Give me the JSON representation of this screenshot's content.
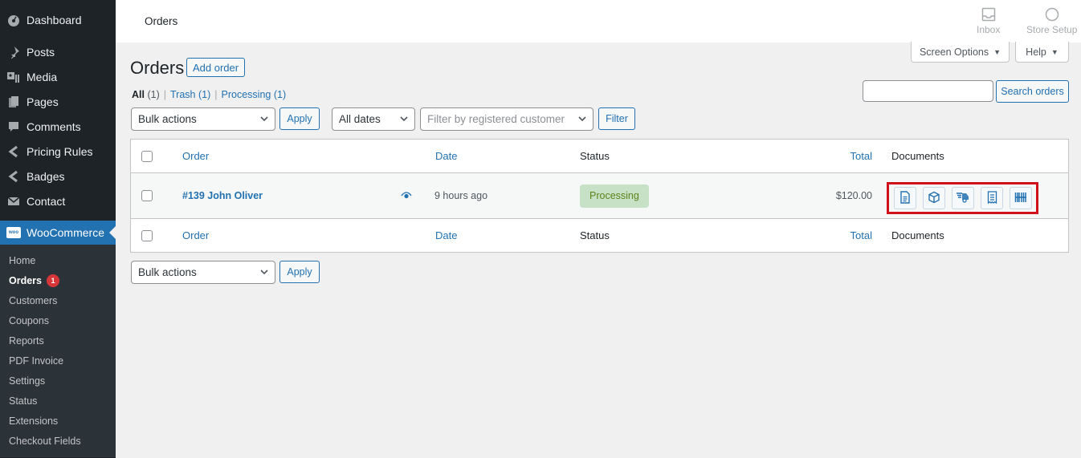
{
  "sidebar": {
    "items": [
      {
        "label": "Dashboard",
        "icon": "dashboard-icon"
      },
      {
        "label": "Posts",
        "icon": "pin-icon"
      },
      {
        "label": "Media",
        "icon": "media-icon"
      },
      {
        "label": "Pages",
        "icon": "pages-icon"
      },
      {
        "label": "Comments",
        "icon": "comment-icon"
      },
      {
        "label": "Pricing Rules",
        "icon": "chevron-left-icon"
      },
      {
        "label": "Badges",
        "icon": "chevron-left-icon"
      },
      {
        "label": "Contact",
        "icon": "envelope-icon"
      }
    ],
    "woocommerce": {
      "label": "WooCommerce",
      "logo_text": "woo"
    },
    "submenu": [
      {
        "label": "Home"
      },
      {
        "label": "Orders",
        "badge": "1",
        "current": true
      },
      {
        "label": "Customers"
      },
      {
        "label": "Coupons"
      },
      {
        "label": "Reports"
      },
      {
        "label": "PDF Invoice"
      },
      {
        "label": "Settings"
      },
      {
        "label": "Status"
      },
      {
        "label": "Extensions"
      },
      {
        "label": "Checkout Fields"
      }
    ]
  },
  "topbar": {
    "title": "Orders",
    "actions": [
      {
        "label": "Inbox",
        "icon": "inbox-icon"
      },
      {
        "label": "Store Setup",
        "icon": "circle-progress-icon"
      }
    ]
  },
  "screen_meta": {
    "screen_options": "Screen Options",
    "help": "Help"
  },
  "page": {
    "title": "Orders",
    "add_button": "Add order",
    "views": [
      {
        "label": "All",
        "count": "(1)",
        "current": true
      },
      {
        "label": "Trash",
        "count": "(1)"
      },
      {
        "label": "Processing",
        "count": "(1)"
      }
    ],
    "search": {
      "value": "",
      "button": "Search orders"
    }
  },
  "filters": {
    "bulk_actions": "Bulk actions",
    "apply": "Apply",
    "dates": "All dates",
    "customer_placeholder": "Filter by registered customer",
    "filter": "Filter"
  },
  "table": {
    "columns": [
      "Order",
      "Date",
      "Status",
      "Total",
      "Documents"
    ],
    "rows": [
      {
        "order": "#139 John Oliver",
        "date": "9 hours ago",
        "status": "Processing",
        "total": "$120.00",
        "documents": [
          "invoice-icon",
          "packing-slip-icon",
          "delivery-note-icon",
          "receipt-icon",
          "barcode-icon"
        ]
      }
    ]
  },
  "colors": {
    "accent": "#2271b1",
    "sidebar_bg": "#1d2327",
    "status_processing_bg": "#c6e1c6",
    "status_processing_text": "#5b841b",
    "highlight_box": "#d0101a",
    "badge": "#d63638"
  }
}
